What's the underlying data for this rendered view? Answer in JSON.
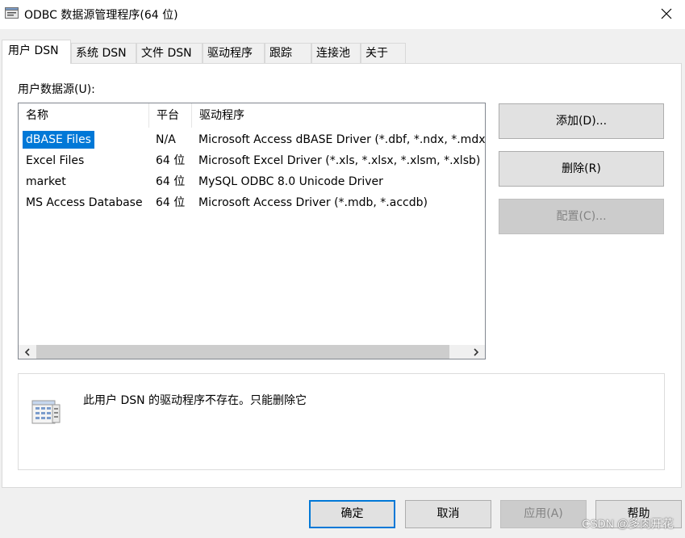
{
  "window": {
    "title": "ODBC 数据源管理程序(64 位)",
    "close_glyph": "✕"
  },
  "tabs": [
    {
      "label": "用户 DSN",
      "active": true
    },
    {
      "label": "系统 DSN",
      "active": false
    },
    {
      "label": "文件 DSN",
      "active": false
    },
    {
      "label": "驱动程序",
      "active": false
    },
    {
      "label": "跟踪",
      "active": false
    },
    {
      "label": "连接池",
      "active": false
    },
    {
      "label": "关于",
      "active": false
    }
  ],
  "user_dsn": {
    "label": "用户数据源(U):",
    "columns": [
      "名称",
      "平台",
      "驱动程序"
    ],
    "rows": [
      {
        "name": "dBASE Files",
        "platform": "N/A",
        "driver": "Microsoft Access dBASE Driver (*.dbf, *.ndx, *.mdx)",
        "selected": true
      },
      {
        "name": "Excel Files",
        "platform": "64 位",
        "driver": "Microsoft Excel Driver (*.xls, *.xlsx, *.xlsm, *.xlsb)",
        "selected": false
      },
      {
        "name": "market",
        "platform": "64 位",
        "driver": "MySQL ODBC 8.0 Unicode Driver",
        "selected": false
      },
      {
        "name": "MS Access Database",
        "platform": "64 位",
        "driver": "Microsoft Access Driver (*.mdb, *.accdb)",
        "selected": false
      }
    ],
    "scroll_left_glyph": "<",
    "scroll_right_glyph": ">"
  },
  "side_buttons": {
    "add": "添加(D)...",
    "remove": "删除(R)",
    "configure": "配置(C)..."
  },
  "info": {
    "text": "此用户 DSN 的驱动程序不存在。只能删除它"
  },
  "bottom_buttons": {
    "ok": "确定",
    "cancel": "取消",
    "apply": "应用(A)",
    "help": "帮助"
  },
  "watermark": "CSDN @多肉开花",
  "colors": {
    "selection": "#0078d7",
    "default_button_border": "#0078d7"
  }
}
